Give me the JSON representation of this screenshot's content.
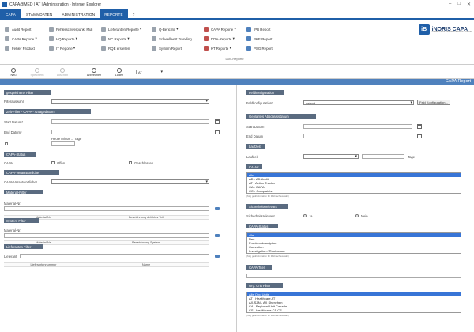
{
  "window": {
    "title": "CAPA@MED | AT | Administration - Internet Explorer"
  },
  "menu": {
    "items": [
      "CAPA",
      "STAMMDATEN",
      "ADMINISTRATION",
      "REPORTE",
      "?"
    ],
    "active_index": 3
  },
  "ribbon": {
    "col1": [
      "Audit Report",
      "CAPA Reporte",
      "Fehler Produkt"
    ],
    "col2": [
      "Fehlerschwerpunkt Muli",
      "HQ Reporte",
      "IT Reporte"
    ],
    "col3": [
      "Lieferanten Reporte",
      "NC Reporte",
      "RQE erstellen"
    ],
    "col4": [
      "Q-Berichte",
      "Schwellwert Trending",
      "System Report"
    ],
    "col5": [
      "CAPA Reporte",
      "DDA-Reporte",
      "KT Reporte"
    ],
    "col6": [
      "IPB Report",
      "PKE-Report",
      "PSG Report"
    ],
    "group_label": "DJB-Reporte"
  },
  "brand": {
    "mark": "iB",
    "name": "iNORIS CAPA",
    "tagline": "CORRECTIVE AND PREVENTIVE ACTION"
  },
  "toolbar": {
    "buttons": [
      "Neu",
      "Speichern",
      "Löschen",
      "Abbrechen",
      "Laden"
    ],
    "select_value": "AT"
  },
  "banner": {
    "title": "CAPA Report"
  },
  "left": {
    "saved_filter": {
      "header": "gespeicherte Filter",
      "label": "Filterauswahl"
    },
    "time_filter": {
      "header": "Zeit-Filter - CAPA - Anlagedatum",
      "start_label": "Start Datum*",
      "end_label": "End Datum*",
      "today_label": "Heute minus ... Tage"
    },
    "capa_status": {
      "header": "CAPA-Status",
      "label": "CAPA",
      "opt_open": "Offen",
      "opt_closed": "Geschlossen"
    },
    "capa_resp": {
      "header": "CAPA-Verantwortlicher",
      "label": "CAPA Verantwortlicher",
      "value": "-----"
    },
    "material": {
      "header": "Material-Filter",
      "label": "Material-Nr.",
      "col1": "Material-Nr.",
      "col2": "Bezeichnung defektes Teil"
    },
    "system": {
      "header": "System-Filter",
      "label": "Material-Nr.",
      "col1": "Material-Nr.",
      "col2": "Bezeichnung System"
    },
    "supplier": {
      "header": "Lieferanten Filter",
      "label": "Lieferant",
      "col1": "Lieferantennummer",
      "col2": "Name"
    }
  },
  "right": {
    "field_config": {
      "header": "Feldkonfiguration",
      "label": "Feldkonfiguration*",
      "value": "default",
      "button": "Feld Konfiguration..."
    },
    "closing": {
      "header": "Geplantes Abschlussdatum",
      "start_label": "Start Datum",
      "end_label": "End Datum"
    },
    "runtime": {
      "header": "Laufzeit",
      "label": "Laufzeit",
      "unit": "Tage"
    },
    "ca_type": {
      "header": "CA-Art",
      "items": [
        "alle",
        "AD - AD-Audit",
        "AT - Action Tracker",
        "CA - CAPA",
        "CC - Complaints"
      ],
      "hint": "(Strg gedrückt halten für Mehrfachauswahl)"
    },
    "safety": {
      "header": "Sicherheitsrelevant",
      "label": "Sicherheitsrelevant",
      "opt_yes": "Ja",
      "opt_no": "Nein"
    },
    "capa_status": {
      "header": "CAPA-Status",
      "items": [
        "alle",
        "Neu",
        "Problem description",
        "Correction",
        "Investigation / Root cause"
      ],
      "hint": "(Strg gedrückt halten für Mehrfachauswahl)"
    },
    "capa_title": {
      "header": "CAPA Titel"
    },
    "org_unit": {
      "header": "Org. Unit Filter",
      "items": [
        "Alle Org. Units",
        "AT - Healthcare AT",
        "AX-SZN - AX Shenzhen",
        "CA - Regional Unit Canada",
        "CS - Healthcare CS CS"
      ],
      "hint": "(Strg gedrückt halten für Mehrfachauswahl)"
    }
  }
}
